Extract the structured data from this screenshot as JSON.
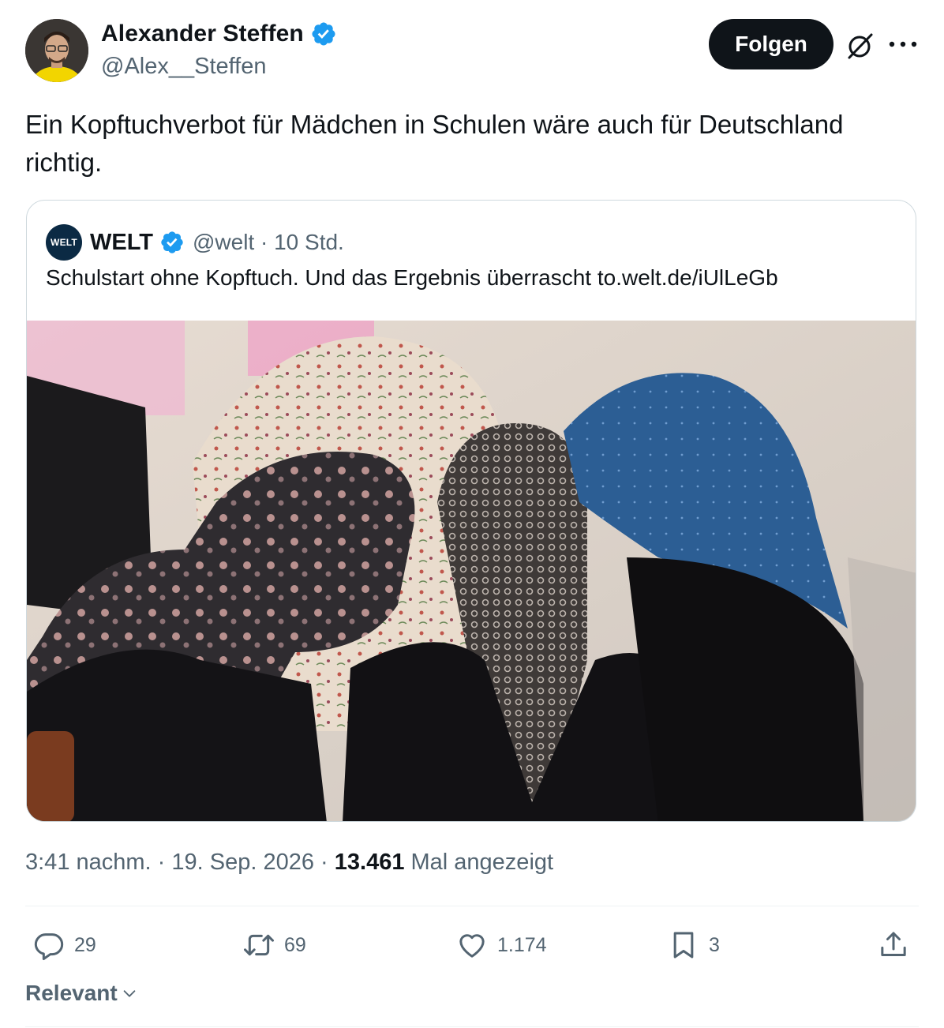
{
  "author": {
    "name": "Alexander Steffen",
    "handle": "@Alex__Steffen",
    "verified": true,
    "avatar_icon": "avatar-portrait",
    "follow_label": "Folgen"
  },
  "tweet": {
    "text": "Ein Kopftuchverbot für Mädchen in Schulen wäre auch für Deutschland richtig."
  },
  "quote": {
    "logo_text": "WELT",
    "name": "WELT",
    "handle": "@welt · 10 Std.",
    "text": "Schulstart ohne Kopftuch. Und das Ergebnis überrascht to.welt.de/iUlLeGb",
    "image_icon": "photo-four-women-in-headscarves"
  },
  "meta": {
    "time_date": "3:41 nachm. · 19. Sep. 2026 · ",
    "views": "13.461",
    "views_suffix": " Mal angezeigt"
  },
  "actions": {
    "replies": "29",
    "reposts": "69",
    "likes": "1.174",
    "bookmarks": "3"
  },
  "sort": {
    "label": "Relevant"
  },
  "colors": {
    "verified_blue": "#1d9bf0",
    "secondary_text": "#536471",
    "primary_text": "#0f1419",
    "welt_navy": "#0b2a44"
  }
}
